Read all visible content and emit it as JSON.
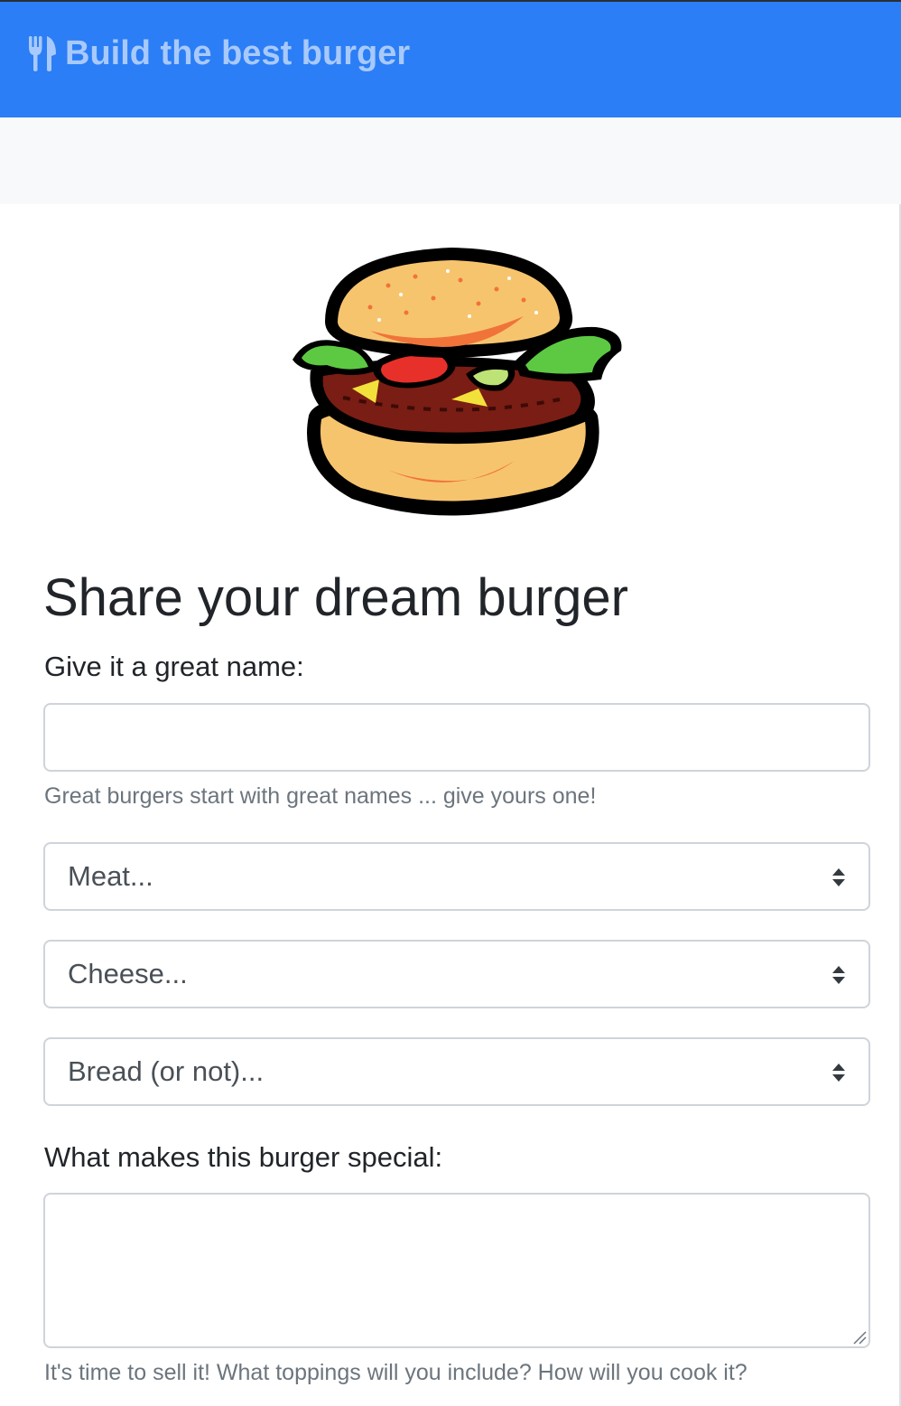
{
  "header": {
    "brand_text": "Build the best burger",
    "brand_icon": "utensils-icon",
    "background_color": "#2b7ef5",
    "brand_color": "#a8c9fb"
  },
  "main": {
    "hero_image": "burger-illustration",
    "title": "Share your dream burger",
    "name_field": {
      "label": "Give it a great name:",
      "value": "",
      "help_text": "Great burgers start with great names ... give yours one!"
    },
    "selects": {
      "meat": "Meat...",
      "cheese": "Cheese...",
      "bread": "Bread (or not)..."
    },
    "description_field": {
      "label": "What makes this burger special:",
      "value": "",
      "help_text": "It's time to sell it! What toppings will you include? How will you cook it?"
    }
  }
}
